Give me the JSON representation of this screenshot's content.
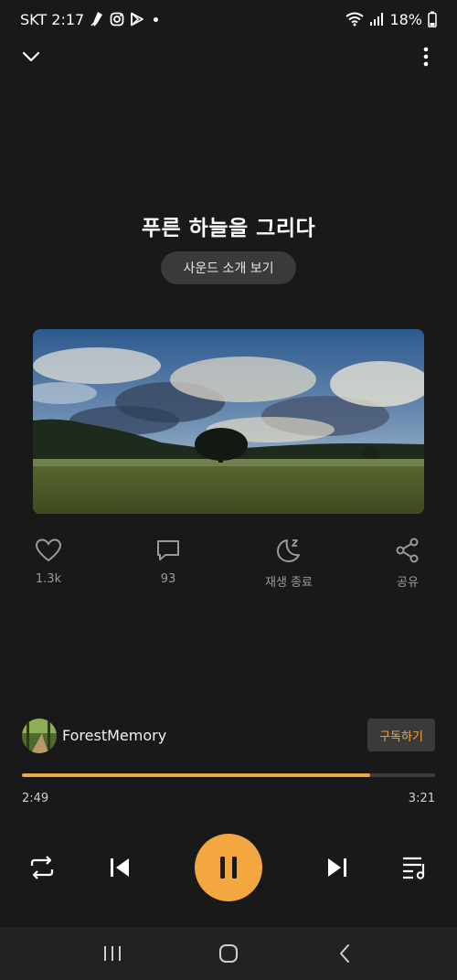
{
  "status_bar": {
    "carrier_time": "SKT 2:17",
    "battery": "18%",
    "icons": [
      "app-notification-icon",
      "instagram-icon",
      "play-store-icon",
      "wifi-icon",
      "signal-icon",
      "battery-icon"
    ]
  },
  "header": {
    "collapse_icon": "chevron-down-icon",
    "more_icon": "more-vertical-icon"
  },
  "track": {
    "title": "푸른 하늘을 그리다",
    "intro_button": "사운드 소개 보기"
  },
  "actions": [
    {
      "icon": "heart-icon",
      "label": "1.3k"
    },
    {
      "icon": "comment-icon",
      "label": "93"
    },
    {
      "icon": "sleep-timer-icon",
      "label": "재생 종료"
    },
    {
      "icon": "share-icon",
      "label": "공유"
    }
  ],
  "artist": {
    "name": "ForestMemory",
    "subscribe_label": "구독하기"
  },
  "player": {
    "current_time": "2:49",
    "total_time": "3:21",
    "progress_fraction": 0.842
  },
  "controls": [
    "repeat-icon",
    "previous-icon",
    "pause-icon",
    "next-icon",
    "playlist-icon"
  ],
  "colors": {
    "accent": "#f4a63f",
    "background": "#191919",
    "button_bg": "#3a3a3a"
  },
  "nav": [
    "recent-apps-icon",
    "home-icon",
    "back-icon"
  ]
}
